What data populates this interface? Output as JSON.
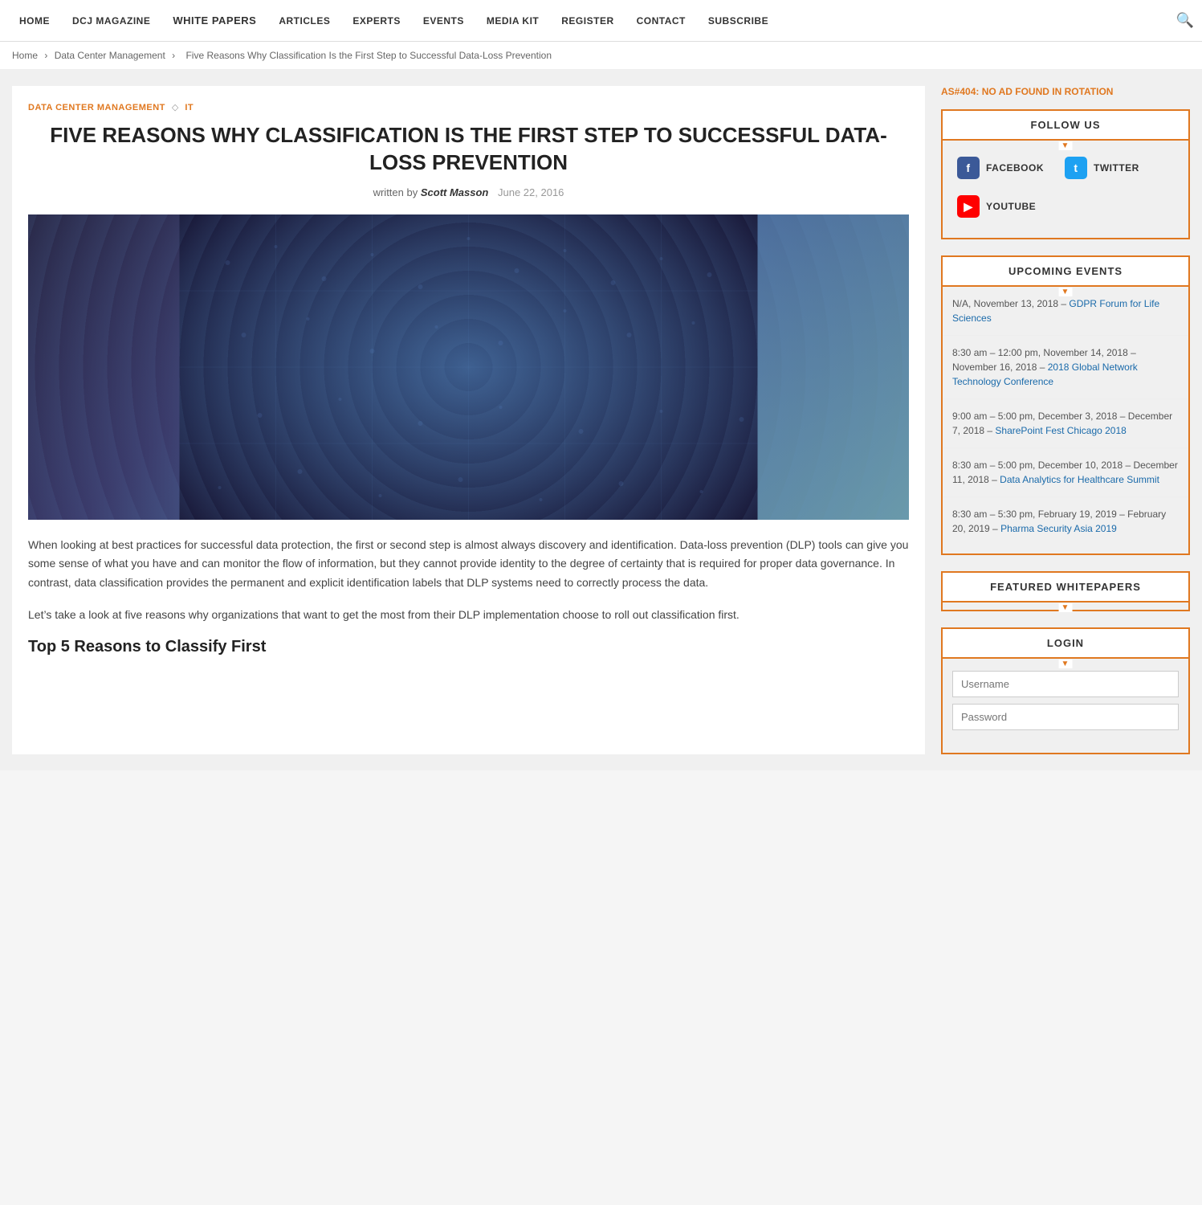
{
  "nav": {
    "items": [
      {
        "label": "HOME",
        "id": "home"
      },
      {
        "label": "DCJ MAGAZINE",
        "id": "dcj-magazine"
      },
      {
        "label": "WHITE PAPERS",
        "id": "white-papers"
      },
      {
        "label": "ARTICLES",
        "id": "articles"
      },
      {
        "label": "EXPERTS",
        "id": "experts"
      },
      {
        "label": "EVENTS",
        "id": "events"
      },
      {
        "label": "MEDIA KIT",
        "id": "media-kit"
      },
      {
        "label": "REGISTER",
        "id": "register"
      },
      {
        "label": "CONTACT",
        "id": "contact"
      },
      {
        "label": "SUBSCRIBE",
        "id": "subscribe"
      }
    ]
  },
  "breadcrumb": {
    "home": "Home",
    "category": "Data Center Management",
    "current": "Five Reasons Why Classification Is the First Step to Successful Data-Loss Prevention"
  },
  "article": {
    "category": "DATA CENTER MANAGEMENT",
    "category2": "IT",
    "title": "FIVE REASONS WHY CLASSIFICATION IS THE FIRST STEP TO SUCCESSFUL DATA-LOSS PREVENTION",
    "written_by": "written by",
    "author": "Scott Masson",
    "date": "June 22, 2016",
    "body_p1": "When looking at best practices for successful data protection, the first or second step is almost always discovery and identification. Data-loss prevention (DLP) tools can give you some sense of what you have and can monitor the flow of information, but they cannot provide identity to the degree of certainty that is required for proper data governance. In contrast, data classification provides the permanent and explicit identification labels that DLP systems need to correctly process the data.",
    "body_p2": "Let’s take a look at five reasons why organizations that want to get the most from their DLP implementation choose to roll out classification first.",
    "subheading": "Top 5 Reasons to Classify First"
  },
  "sidebar": {
    "ad_text": "AS#404: NO AD FOUND IN ROTATION",
    "follow_us": {
      "header": "FOLLOW US",
      "facebook_label": "FACEBOOK",
      "twitter_label": "TWITTER",
      "youtube_label": "YOUTUBE"
    },
    "upcoming_events": {
      "header": "UPCOMING EVENTS",
      "events": [
        {
          "date": "N/A, November 13, 2018 –",
          "link_text": "GDPR Forum for Life Sciences",
          "link": "#"
        },
        {
          "date": "8:30 am – 12:00 pm, November 14, 2018 – November 16, 2018 –",
          "link_text": "2018 Global Network Technology Conference",
          "link": "#"
        },
        {
          "date": "9:00 am – 5:00 pm, December 3, 2018 – December 7, 2018 –",
          "link_text": "SharePoint Fest Chicago 2018",
          "link": "#"
        },
        {
          "date": "8:30 am – 5:00 pm, December 10, 2018 – December 11, 2018 –",
          "link_text": "Data Analytics for Healthcare Summit",
          "link": "#"
        },
        {
          "date": "8:30 am – 5:30 pm, February 19, 2019 – February 20, 2019 –",
          "link_text": "Pharma Security Asia 2019",
          "link": "#"
        }
      ]
    },
    "featured_whitepapers": {
      "header": "FEATURED WHITEPAPERS"
    },
    "login": {
      "header": "LOGIN",
      "username_label": "Username",
      "password_label": "Password"
    }
  }
}
